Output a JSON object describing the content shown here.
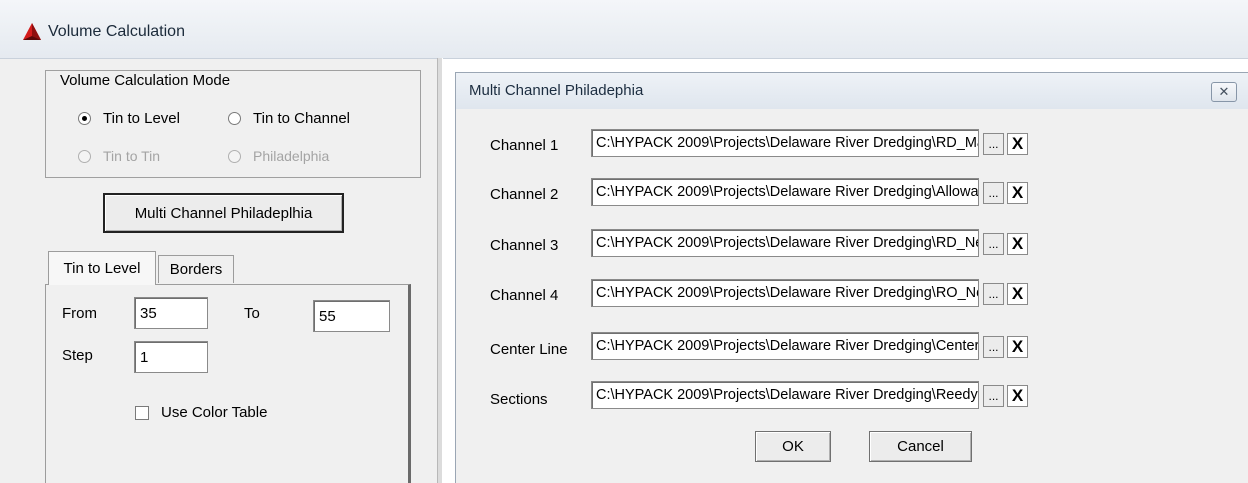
{
  "back_window": {
    "title": "Volume Calculation",
    "mode_group": {
      "label": "Volume Calculation  Mode",
      "options": [
        {
          "label": "Tin to Level",
          "checked": true,
          "enabled": true
        },
        {
          "label": "Tin to Channel",
          "checked": false,
          "enabled": true
        },
        {
          "label": "Tin to Tin",
          "checked": false,
          "enabled": false
        },
        {
          "label": "Philadelphia",
          "checked": false,
          "enabled": false
        }
      ]
    },
    "multi_channel_button": "Multi Channel Philadeplhia",
    "tabs": [
      "Tin to Level",
      "Borders"
    ],
    "level_form": {
      "from_label": "From",
      "from_value": "35",
      "to_label": "To",
      "to_value": "55",
      "step_label": "Step",
      "step_value": "1",
      "color_table_label": "Use Color Table"
    }
  },
  "dialog": {
    "title": "Multi Channel Philadephia",
    "close_glyph": "✕",
    "rows": [
      {
        "label": "Channel 1",
        "value": "C:\\HYPACK 2009\\Projects\\Delaware River Dredging\\RD_Maintenance.chn"
      },
      {
        "label": "Channel 2",
        "value": "C:\\HYPACK 2009\\Projects\\Delaware River Dredging\\AllowableOverdepth_l"
      },
      {
        "label": "Channel 3",
        "value": "C:\\HYPACK 2009\\Projects\\Delaware River Dredging\\RD_New.chn"
      },
      {
        "label": "Channel 4",
        "value": "C:\\HYPACK 2009\\Projects\\Delaware River Dredging\\RO_New.chn"
      },
      {
        "label": "Center Line",
        "value": "C:\\HYPACK 2009\\Projects\\Delaware River Dredging\\CenterlineReedy.lnw"
      },
      {
        "label": "Sections",
        "value": "C:\\HYPACK 2009\\Projects\\Delaware River Dredging\\ReedyIslandSubLInes"
      }
    ],
    "browse_label": "...",
    "clear_label": "X",
    "ok_label": "OK",
    "cancel_label": "Cancel"
  }
}
